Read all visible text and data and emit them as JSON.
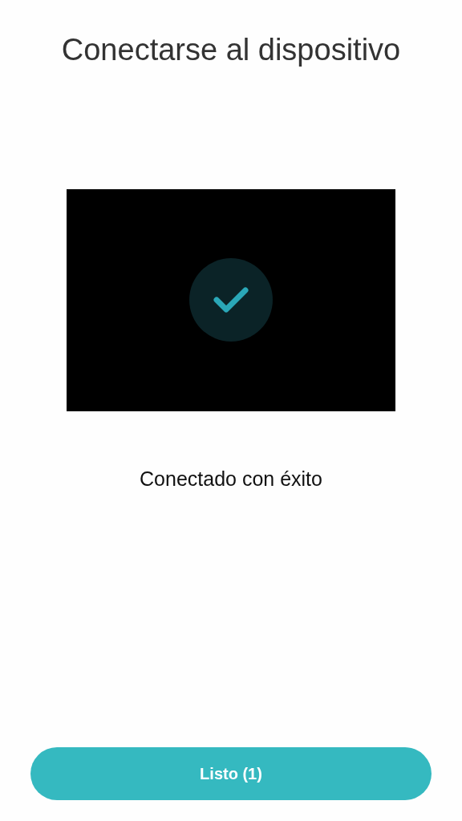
{
  "title": "Conectarse al dispositivo",
  "message": "Conectado con éxito",
  "button": {
    "label": "Listo (1)"
  }
}
